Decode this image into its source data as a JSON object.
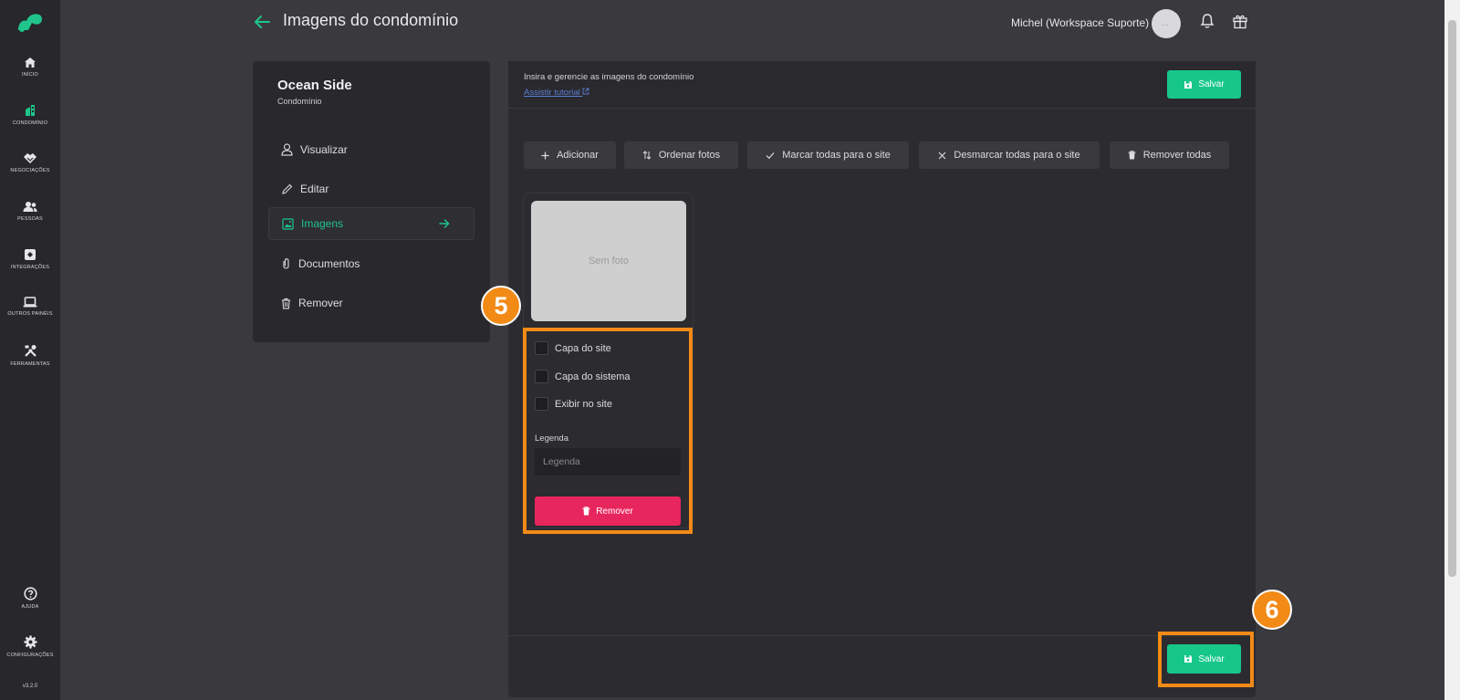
{
  "app": {
    "version": "v3.2.0"
  },
  "rail": {
    "items": [
      {
        "label": "INÍCIO",
        "icon": "home-icon"
      },
      {
        "label": "CONDOMÍNIO",
        "icon": "building-icon"
      },
      {
        "label": "NEGOCIAÇÕES",
        "icon": "handshake-icon"
      },
      {
        "label": "PESSOAS",
        "icon": "people-icon"
      },
      {
        "label": "INTEGRAÇÕES",
        "icon": "integration-icon"
      },
      {
        "label": "OUTROS PAINÉIS",
        "icon": "laptop-icon"
      },
      {
        "label": "FERRAMENTAS",
        "icon": "tools-icon"
      },
      {
        "label": "AJUDA",
        "icon": "help-icon"
      },
      {
        "label": "CONFIGURAÇÕES",
        "icon": "gear-icon"
      }
    ]
  },
  "header": {
    "title": "Imagens do condomínio",
    "user": "Michel (Workspace Suporte)"
  },
  "side": {
    "title": "Ocean Side",
    "subtitle": "Condomínio",
    "menu": [
      {
        "label": "Visualizar",
        "icon": "user-icon"
      },
      {
        "label": "Editar",
        "icon": "pencil-icon"
      },
      {
        "label": "Imagens",
        "icon": "image-icon"
      },
      {
        "label": "Documentos",
        "icon": "paperclip-icon"
      },
      {
        "label": "Remover",
        "icon": "trash-icon"
      }
    ]
  },
  "main": {
    "description": "Insira e gerencie as imagens do condomínio",
    "tutorial": "Assistir tutorial",
    "save_label": "Salvar",
    "toolbar": {
      "add": "Adicionar",
      "order": "Ordenar fotos",
      "mark_all": "Marcar todas para o site",
      "unmark_all": "Desmarcar todas para o site",
      "remove_all": "Remover todas"
    },
    "card": {
      "no_photo": "Sem foto",
      "site_cover": "Capa do site",
      "system_cover": "Capa do sistema",
      "show_on_site": "Exibir no site",
      "legend_label": "Legenda",
      "legend_placeholder": "Legenda",
      "remove": "Remover"
    }
  },
  "callouts": {
    "card_number": "5",
    "save_number": "6"
  },
  "colors": {
    "accent": "#17c78a",
    "danger": "#e8265e",
    "highlight": "#f28a16"
  }
}
